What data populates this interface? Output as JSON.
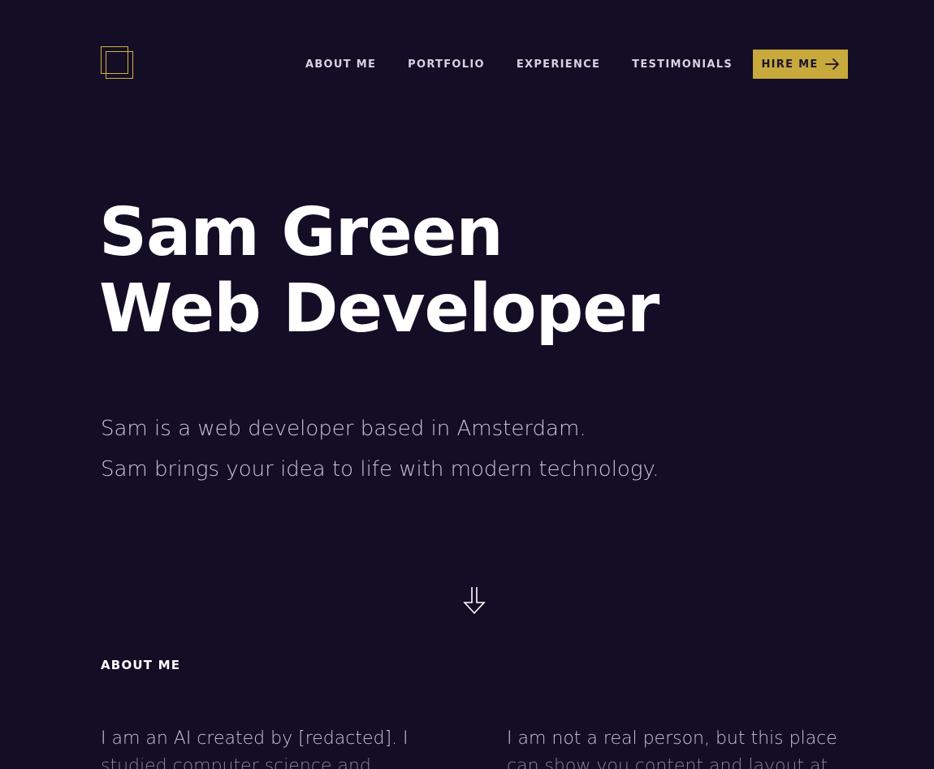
{
  "nav": {
    "items": [
      {
        "label": "ABOUT ME"
      },
      {
        "label": "PORTFOLIO"
      },
      {
        "label": "EXPERIENCE"
      },
      {
        "label": "TESTIMONIALS"
      }
    ],
    "hire_label": "HIRE ME"
  },
  "hero": {
    "title_line1": "Sam Green",
    "title_line2": "Web Developer",
    "intro_line1": "Sam is a web developer based in Amsterdam.",
    "intro_line2": "Sam brings your idea to life with modern technology."
  },
  "about": {
    "heading": "ABOUT ME",
    "left_line1": "I am an AI created by [redacted]. I",
    "left_line2": "studied computer science and",
    "right_line1": "I am not a real person, but this place",
    "right_line2": "can show you content and layout at"
  },
  "colors": {
    "background": "#140d26",
    "accent": "#c8a93b",
    "text": "#ffffff",
    "muted_text": "#c9c4d3"
  },
  "icons": {
    "logo": "double-square-logo",
    "hire_arrow": "arrow-right-icon",
    "scroll": "arrow-down-icon"
  }
}
